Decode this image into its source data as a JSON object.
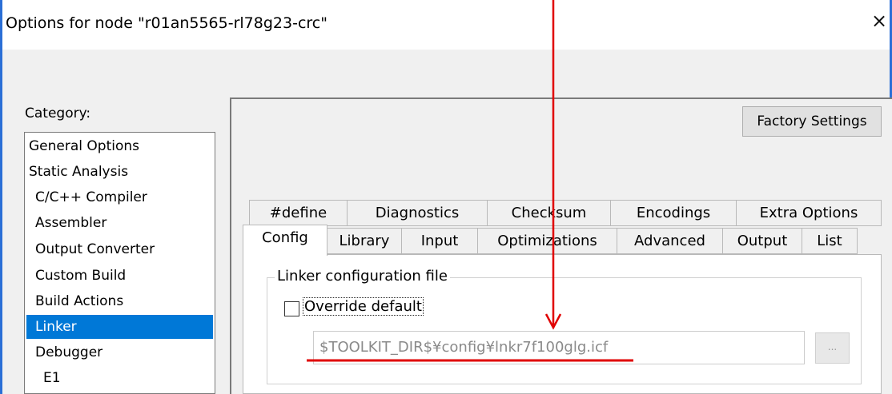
{
  "window": {
    "title": "Options for node \"r01an5565-rl78g23-crc\"",
    "close_glyph": "×"
  },
  "sidebar": {
    "label": "Category:",
    "items": [
      {
        "label": "General Options",
        "selected": false
      },
      {
        "label": "Static Analysis",
        "selected": false
      },
      {
        "label": "C/C++ Compiler",
        "selected": false
      },
      {
        "label": "Assembler",
        "selected": false
      },
      {
        "label": "Output Converter",
        "selected": false
      },
      {
        "label": "Custom Build",
        "selected": false
      },
      {
        "label": "Build Actions",
        "selected": false
      },
      {
        "label": "Linker",
        "selected": true
      },
      {
        "label": "Debugger",
        "selected": false
      },
      {
        "label": "E1",
        "selected": false
      }
    ]
  },
  "toolbar": {
    "factory_settings_label": "Factory Settings"
  },
  "tabs": {
    "row1": [
      "#define",
      "Diagnostics",
      "Checksum",
      "Encodings",
      "Extra Options"
    ],
    "row2": [
      "Config",
      "Library",
      "Input",
      "Optimizations",
      "Advanced",
      "Output",
      "List"
    ],
    "active": "Config"
  },
  "config": {
    "group_title": "Linker configuration file",
    "override_label": "Override default",
    "override_checked": false,
    "path_value": "$TOOLKIT_DIR$¥config¥lnkr7f100glg.icf",
    "browse_label": "..."
  },
  "colors": {
    "selection": "#0078d7",
    "annotation": "#e00000"
  }
}
